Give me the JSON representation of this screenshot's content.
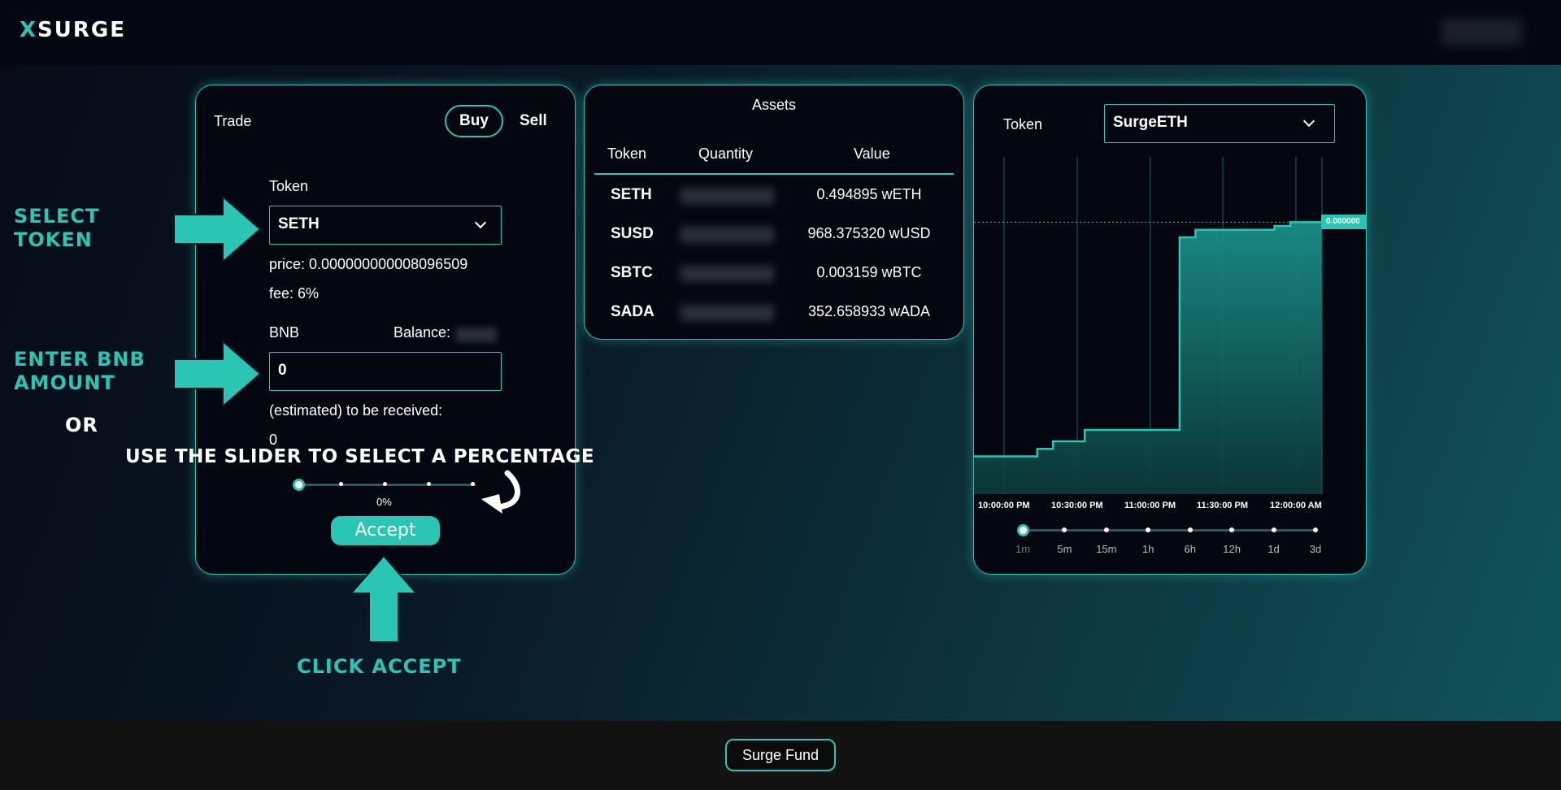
{
  "header": {
    "logo_x": "X",
    "logo_rest": "SURGE"
  },
  "trade": {
    "title": "Trade",
    "buy_label": "Buy",
    "sell_label": "Sell",
    "token_label": "Token",
    "token_selected": "SETH",
    "price_text": "price: 0.000000000008096509",
    "fee_text": "fee: 6%",
    "bnb_label": "BNB",
    "balance_label": "Balance:",
    "bnb_amount": "0",
    "estimated_label": "(estimated) to be received:",
    "estimated_value": "0",
    "slider_percent_label": "0%",
    "slider_value": 0,
    "accept_label": "Accept"
  },
  "assets": {
    "title": "Assets",
    "columns": [
      "Token",
      "Quantity",
      "Value"
    ],
    "rows": [
      {
        "token": "SETH",
        "value": "0.494895 wETH"
      },
      {
        "token": "SUSD",
        "value": "968.375320 wUSD"
      },
      {
        "token": "SBTC",
        "value": "0.003159 wBTC"
      },
      {
        "token": "SADA",
        "value": "352.658933 wADA"
      }
    ]
  },
  "chart_panel": {
    "token_label": "Token",
    "token_selected": "SurgeETH",
    "price_tag": "0.000000",
    "timeframes": [
      "1m",
      "5m",
      "15m",
      "1h",
      "6h",
      "12h",
      "1d",
      "3d"
    ],
    "selected_timeframe": "1m"
  },
  "chart_data": {
    "type": "area",
    "x_labels": [
      "10:00:00 PM",
      "10:30:00 PM",
      "11:00:00 PM",
      "11:30:00 PM",
      "12:00:00 AM"
    ],
    "series": [
      {
        "values": [
          0.1,
          0.1,
          0.1,
          0.1,
          0.12,
          0.14,
          0.14,
          0.17,
          0.17,
          0.17,
          0.17,
          0.17,
          0.17,
          0.68,
          0.7,
          0.7,
          0.7,
          0.7,
          0.7,
          0.71,
          0.72,
          0.72,
          0.72
        ]
      }
    ],
    "color": "#2bc5b4"
  },
  "footer": {
    "fund_label": "Surge Fund"
  },
  "tutorial": {
    "select_token": "Select Token",
    "enter_amount": "Enter BNB Amount",
    "or": "or",
    "slider": "Use the slider to select a percentage",
    "click_accept": "Click Accept"
  }
}
